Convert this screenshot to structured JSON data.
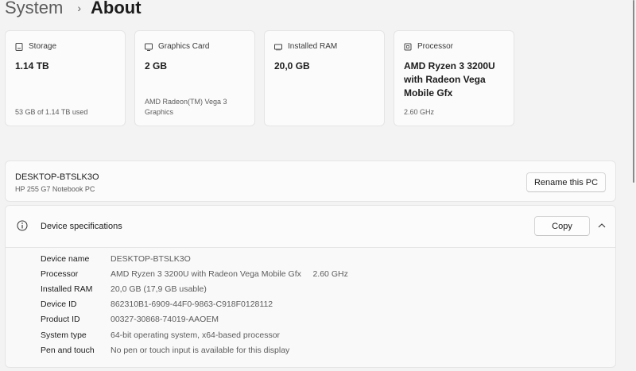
{
  "breadcrumb": {
    "parent": "System",
    "separator": "›",
    "current": "About"
  },
  "cards": [
    {
      "title": "Storage",
      "value": "1.14 TB",
      "sub": "53 GB of 1.14 TB used",
      "icon": "storage-icon"
    },
    {
      "title": "Graphics Card",
      "value": "2 GB",
      "sub": "AMD Radeon(TM) Vega 3 Graphics",
      "icon": "graphics-card-icon"
    },
    {
      "title": "Installed RAM",
      "value": "20,0 GB",
      "sub": "",
      "icon": "ram-icon"
    },
    {
      "title": "Processor",
      "value": "AMD Ryzen 3 3200U with Radeon Vega Mobile Gfx",
      "sub": "2.60 GHz",
      "icon": "processor-icon"
    }
  ],
  "pc": {
    "name": "DESKTOP-BTSLK3O",
    "model": "HP 255 G7 Notebook PC",
    "rename_label": "Rename this PC"
  },
  "specs": {
    "title": "Device specifications",
    "copy_label": "Copy",
    "rows": [
      {
        "label": "Device name",
        "value": "DESKTOP-BTSLK3O"
      },
      {
        "label": "Processor",
        "value": "AMD Ryzen 3 3200U with Radeon Vega Mobile Gfx     2.60 GHz"
      },
      {
        "label": "Installed RAM",
        "value": "20,0 GB (17,9 GB usable)"
      },
      {
        "label": "Device ID",
        "value": "862310B1-6909-44F0-9863-C918F0128112"
      },
      {
        "label": "Product ID",
        "value": "00327-30868-74019-AAOEM"
      },
      {
        "label": "System type",
        "value": "64-bit operating system, x64-based processor"
      },
      {
        "label": "Pen and touch",
        "value": "No pen or touch input is available for this display"
      }
    ]
  }
}
